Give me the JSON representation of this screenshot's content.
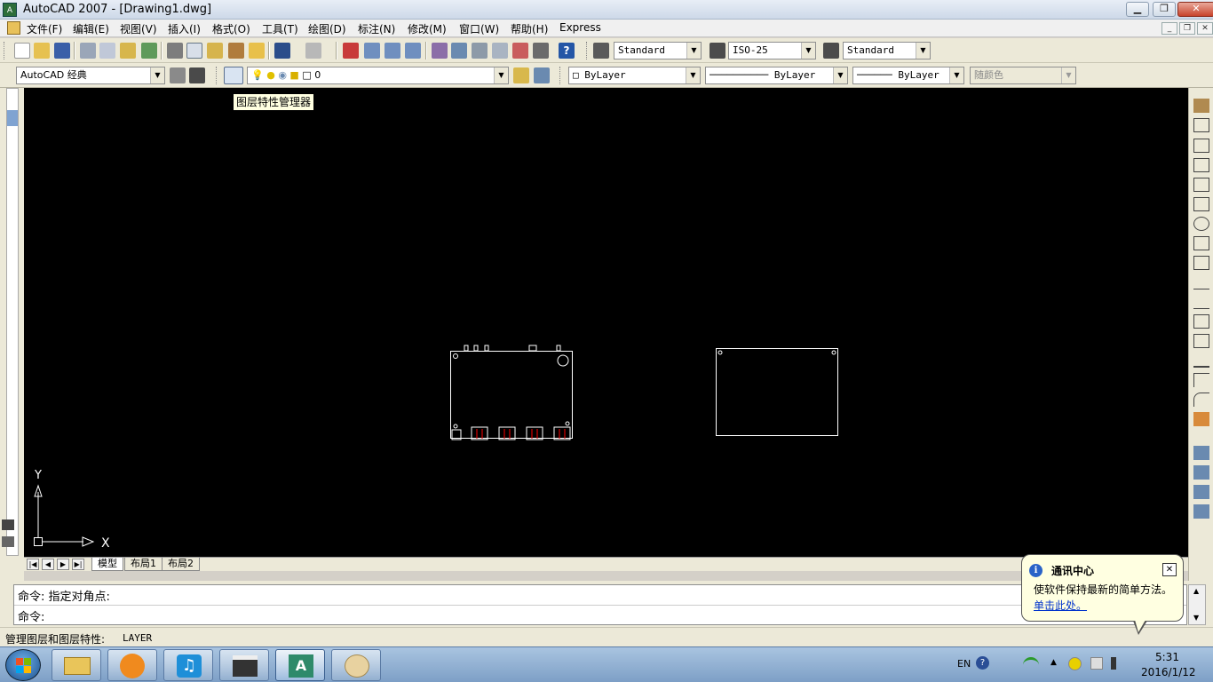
{
  "window": {
    "title": "AutoCAD 2007 - [Drawing1.dwg]",
    "app_icon_text": "A"
  },
  "menu": {
    "items": [
      "文件(F)",
      "编辑(E)",
      "视图(V)",
      "插入(I)",
      "格式(O)",
      "工具(T)",
      "绘图(D)",
      "标注(N)",
      "修改(M)",
      "窗口(W)",
      "帮助(H)",
      "Express"
    ]
  },
  "toolbar1": {
    "text_style": "Standard",
    "dim_style": "ISO-25",
    "table_style": "Standard"
  },
  "toolbar2": {
    "workspace": "AutoCAD 经典",
    "layer": "0",
    "color": "ByLayer",
    "linetype": "ByLayer",
    "lineweight": "ByLayer",
    "plot_style": "随颜色"
  },
  "tooltip": {
    "text": "图层特性管理器"
  },
  "canvas": {
    "ucs_x_label": "X",
    "ucs_y_label": "Y"
  },
  "tabs": {
    "items": [
      "模型",
      "布局1",
      "布局2"
    ],
    "active": "模型"
  },
  "command": {
    "history_line": "命令: 指定对角点:",
    "prompt": "命令:"
  },
  "status": {
    "text": "管理图层和图层特性:",
    "command": "LAYER"
  },
  "balloon": {
    "title": "通讯中心",
    "message": "使软件保持最新的简单方法。",
    "link": "单击此处。"
  },
  "tray": {
    "lang": "EN",
    "time": "5:31",
    "date": "2016/1/12"
  },
  "colors": {
    "canvas": "#000000",
    "drawing_lines": "#ffffff",
    "accent_red": "#ff0000",
    "taskbar": "#7d9fc6"
  },
  "icons": {
    "taskbar": [
      "windows-start-icon",
      "file-explorer-icon",
      "uc-browser-icon",
      "music-player-icon",
      "video-clapper-icon",
      "autocad-icon",
      "paint-icon"
    ],
    "right_toolbar": [
      "erase-icon",
      "copy-icon",
      "mirror-icon",
      "offset-icon",
      "array-icon",
      "move-icon",
      "rotate-icon",
      "scale-icon",
      "stretch-icon",
      "trim-icon",
      "extend-icon",
      "break-icon",
      "break-at-point-icon",
      "join-icon",
      "chamfer-icon",
      "fillet-icon",
      "explode-icon",
      "draworder-front-icon",
      "draworder-back-icon",
      "draworder-above-icon",
      "draworder-under-icon"
    ]
  }
}
